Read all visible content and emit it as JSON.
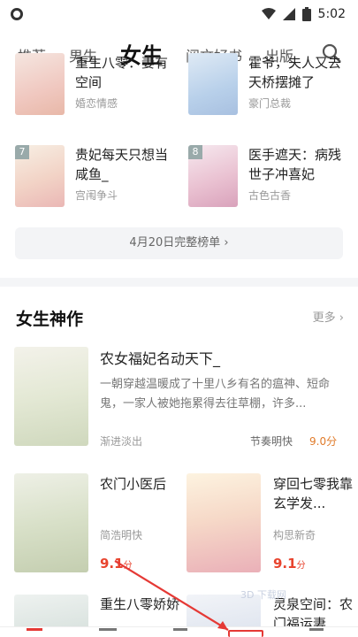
{
  "status_bar": {
    "time": "5:02"
  },
  "tabs": [
    {
      "label": "推荐"
    },
    {
      "label": "男生"
    },
    {
      "label": "女生"
    },
    {
      "label": "阅文好书"
    },
    {
      "label": "出版"
    }
  ],
  "ranking": {
    "items": [
      {
        "title": "重生八零：妻有空间",
        "tag": "婚恋情感",
        "rank": ""
      },
      {
        "title": "霍爷，夫人又去天桥摆摊了",
        "tag": "豪门总裁",
        "rank": ""
      },
      {
        "title": "贵妃每天只想当咸鱼_",
        "tag": "宫闱争斗",
        "rank": "7"
      },
      {
        "title": "医手遮天：病残世子冲喜妃",
        "tag": "古色古香",
        "rank": "8"
      }
    ],
    "full_list_label": "4月20日完整榜单 ›"
  },
  "section": {
    "title": "女生神作",
    "more_label": "更多 ›"
  },
  "featured": {
    "title": "农女福妃名动天下_",
    "desc": "一朝穿越温暖成了十里八乡有名的瘟神、短命鬼，一家人被她拖累得去往草棚，许多...",
    "author": "渐进淡出",
    "tag": "节奏明快",
    "score": "9.0分"
  },
  "grid": [
    {
      "title": "农门小医后",
      "author": "简浩明快",
      "score": "9.1",
      "unit": "分"
    },
    {
      "title": "穿回七零我靠玄学发...",
      "author": "构思新奇",
      "score": "9.1",
      "unit": "分"
    },
    {
      "title": "重生八零娇娇",
      "author": "",
      "score": "",
      "unit": ""
    },
    {
      "title": "灵泉空间：农门福运妻",
      "author": "",
      "score": "",
      "unit": ""
    }
  ],
  "watermark": "3D 下载网",
  "colors": {
    "score": "#e8442e",
    "accent_orange": "#e07b2a",
    "annotation_red": "#e53935"
  }
}
